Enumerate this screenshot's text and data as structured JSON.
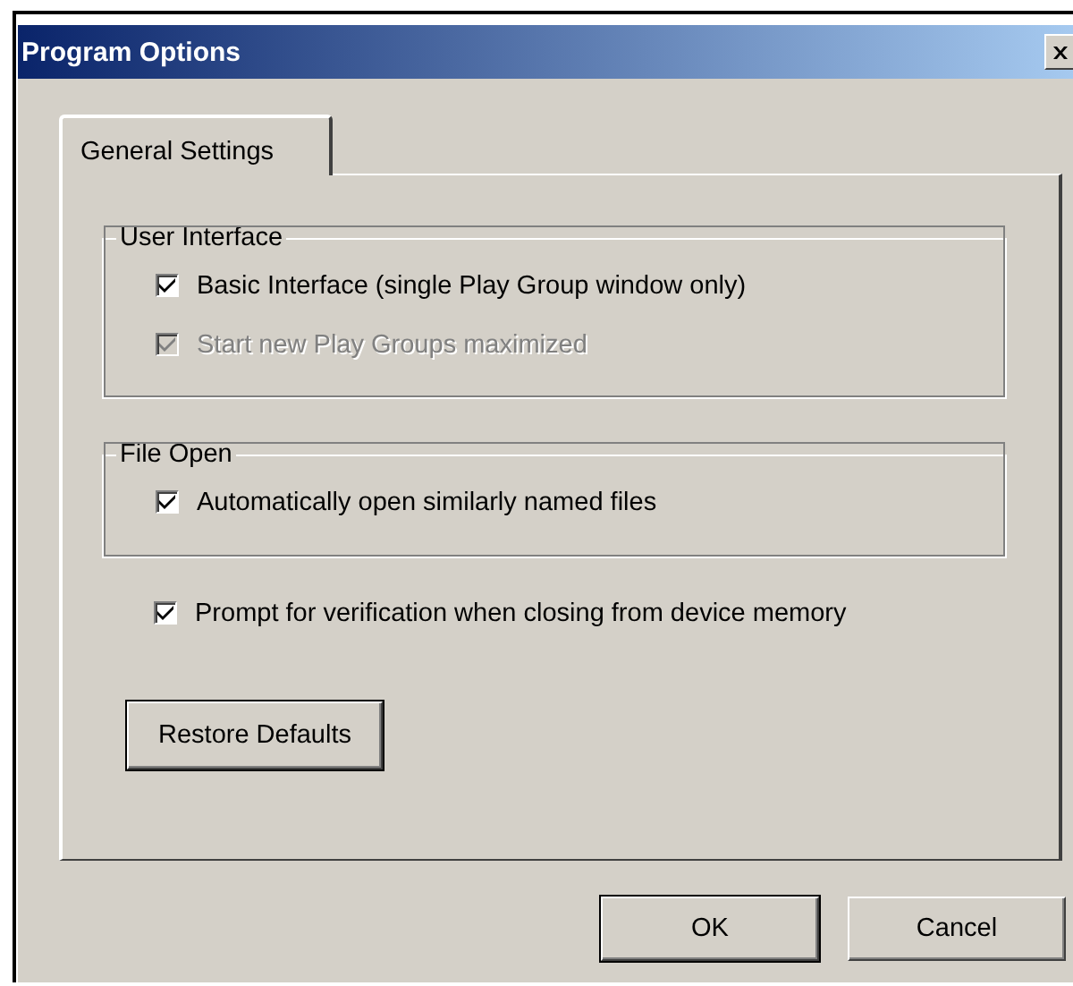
{
  "window": {
    "title": "Program Options"
  },
  "tabs": [
    {
      "label": "General Settings",
      "selected": true
    }
  ],
  "groups": [
    {
      "title": "User Interface",
      "options": [
        {
          "label": "Basic Interface (single Play Group window only)",
          "checked": true,
          "disabled": false
        },
        {
          "label": "Start new Play Groups maximized",
          "checked": true,
          "disabled": true
        }
      ]
    },
    {
      "title": "File Open",
      "options": [
        {
          "label": "Automatically open similarly named files",
          "checked": true,
          "disabled": false
        }
      ]
    }
  ],
  "options": [
    {
      "label": "Prompt for verification when closing from device memory",
      "checked": true,
      "disabled": false
    }
  ],
  "restore_button": "Restore Defaults",
  "buttons": [
    {
      "label": "OK",
      "default": true
    },
    {
      "label": "Cancel",
      "default": false
    }
  ]
}
